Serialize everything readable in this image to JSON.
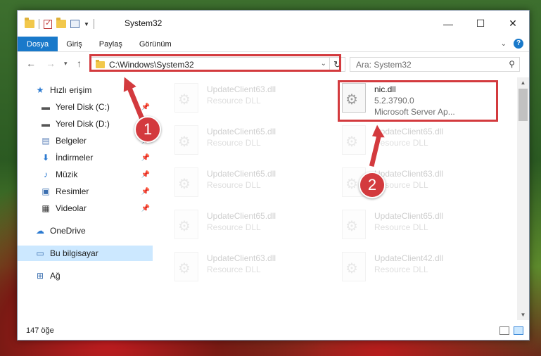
{
  "window": {
    "title": "System32"
  },
  "ribbon": {
    "tabs": [
      "Dosya",
      "Giriş",
      "Paylaş",
      "Görünüm"
    ]
  },
  "address": {
    "path": "C:\\Windows\\System32"
  },
  "search": {
    "placeholder": "Ara: System32"
  },
  "sidebar": {
    "items": [
      {
        "label": "Hızlı erişim",
        "icon": "star-icon"
      },
      {
        "label": "Yerel Disk (C:)",
        "icon": "drive-icon",
        "pinned": true
      },
      {
        "label": "Yerel Disk (D:)",
        "icon": "drive-icon"
      },
      {
        "label": "Belgeler",
        "icon": "documents-icon",
        "pinned": true
      },
      {
        "label": "İndirmeler",
        "icon": "download-icon",
        "pinned": true
      },
      {
        "label": "Müzik",
        "icon": "music-icon",
        "pinned": true
      },
      {
        "label": "Resimler",
        "icon": "pictures-icon",
        "pinned": true
      },
      {
        "label": "Videolar",
        "icon": "videos-icon",
        "pinned": true
      },
      {
        "label": "OneDrive",
        "icon": "cloud-icon"
      },
      {
        "label": "Bu bilgisayar",
        "icon": "computer-icon",
        "selected": true
      },
      {
        "label": "Ağ",
        "icon": "network-icon"
      }
    ]
  },
  "files": [
    {
      "name": "UpdateClient63.dll",
      "desc": "Resource DLL",
      "faded": true
    },
    {
      "name": "nic.dll",
      "desc": "5.2.3790.0",
      "desc2": "Microsoft Server Ap...",
      "faded": false
    },
    {
      "name": "UpdateClient65.dll",
      "desc": "Resource DLL",
      "faded": true
    },
    {
      "name": "UpdateClient65.dll",
      "desc": "Resource DLL",
      "faded": true
    },
    {
      "name": "UpdateClient65.dll",
      "desc": "Resource DLL",
      "faded": true
    },
    {
      "name": "UpdateClient63.dll",
      "desc": "Resource DLL",
      "faded": true
    },
    {
      "name": "UpdateClient65.dll",
      "desc": "Resource DLL",
      "faded": true
    },
    {
      "name": "UpdateClient65.dll",
      "desc": "Resource DLL",
      "faded": true
    },
    {
      "name": "UpdateClient63.dll",
      "desc": "Resource DLL",
      "faded": true
    },
    {
      "name": "UpdateClient42.dll",
      "desc": "Resource DLL",
      "faded": true
    }
  ],
  "status": {
    "count": "147 öğe"
  },
  "annotations": {
    "marker1": "1",
    "marker2": "2",
    "color": "#d33a3e"
  }
}
